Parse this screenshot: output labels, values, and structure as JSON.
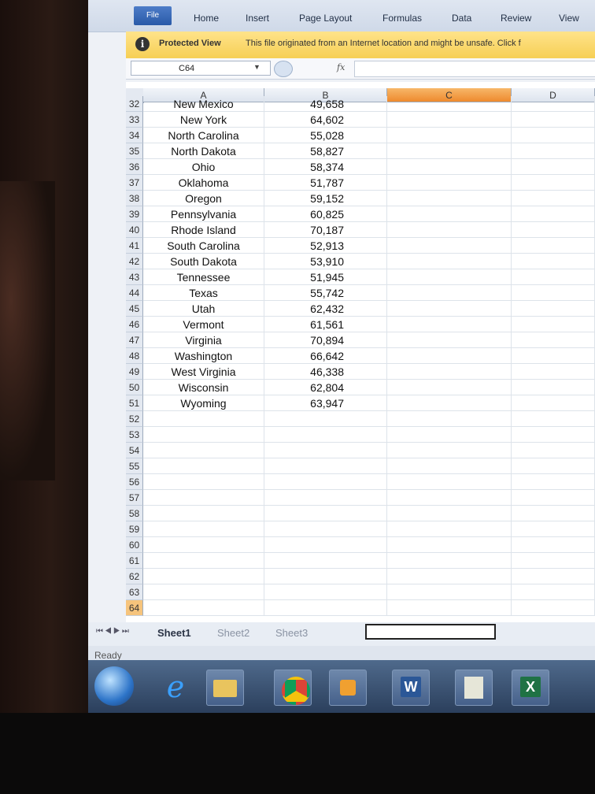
{
  "ribbon": {
    "tabs": [
      "File",
      "Home",
      "Insert",
      "Page Layout",
      "Formulas",
      "Data",
      "Review",
      "View"
    ]
  },
  "protected_view": {
    "label": "Protected View",
    "message": "This file originated from an Internet location and might be unsafe. Click f"
  },
  "formula_bar": {
    "name_box": "C64",
    "fx": "fx",
    "value": ""
  },
  "columns": [
    "A",
    "B",
    "C",
    "D"
  ],
  "selected_column": "C",
  "selected_row": "64",
  "rows": [
    {
      "n": "32",
      "a": "New Mexico",
      "b": "49,658"
    },
    {
      "n": "33",
      "a": "New York",
      "b": "64,602"
    },
    {
      "n": "34",
      "a": "North Carolina",
      "b": "55,028"
    },
    {
      "n": "35",
      "a": "North Dakota",
      "b": "58,827"
    },
    {
      "n": "36",
      "a": "Ohio",
      "b": "58,374"
    },
    {
      "n": "37",
      "a": "Oklahoma",
      "b": "51,787"
    },
    {
      "n": "38",
      "a": "Oregon",
      "b": "59,152"
    },
    {
      "n": "39",
      "a": "Pennsylvania",
      "b": "60,825"
    },
    {
      "n": "40",
      "a": "Rhode Island",
      "b": "70,187"
    },
    {
      "n": "41",
      "a": "South Carolina",
      "b": "52,913"
    },
    {
      "n": "42",
      "a": "South Dakota",
      "b": "53,910"
    },
    {
      "n": "43",
      "a": "Tennessee",
      "b": "51,945"
    },
    {
      "n": "44",
      "a": "Texas",
      "b": "55,742"
    },
    {
      "n": "45",
      "a": "Utah",
      "b": "62,432"
    },
    {
      "n": "46",
      "a": "Vermont",
      "b": "61,561"
    },
    {
      "n": "47",
      "a": "Virginia",
      "b": "70,894"
    },
    {
      "n": "48",
      "a": "Washington",
      "b": "66,642"
    },
    {
      "n": "49",
      "a": "West Virginia",
      "b": "46,338"
    },
    {
      "n": "50",
      "a": "Wisconsin",
      "b": "62,804"
    },
    {
      "n": "51",
      "a": "Wyoming",
      "b": "63,947"
    },
    {
      "n": "52",
      "a": "",
      "b": ""
    },
    {
      "n": "53",
      "a": "",
      "b": ""
    },
    {
      "n": "54",
      "a": "",
      "b": ""
    },
    {
      "n": "55",
      "a": "",
      "b": ""
    },
    {
      "n": "56",
      "a": "",
      "b": ""
    },
    {
      "n": "57",
      "a": "",
      "b": ""
    },
    {
      "n": "58",
      "a": "",
      "b": ""
    },
    {
      "n": "59",
      "a": "",
      "b": ""
    },
    {
      "n": "60",
      "a": "",
      "b": ""
    },
    {
      "n": "61",
      "a": "",
      "b": ""
    },
    {
      "n": "62",
      "a": "",
      "b": ""
    },
    {
      "n": "63",
      "a": "",
      "b": ""
    },
    {
      "n": "64",
      "a": "",
      "b": ""
    }
  ],
  "sheets": [
    "Sheet1",
    "Sheet2",
    "Sheet3"
  ],
  "status": "Ready",
  "taskbar": {
    "apps": [
      "start-orb-icon",
      "internet-explorer-icon",
      "folder-icon",
      "chrome-icon",
      "outlook-icon",
      "word-icon",
      "spreadsheet-icon",
      "excel-icon"
    ],
    "word_glyph": "W",
    "excel_glyph": "X"
  },
  "colors": {
    "protected_bar": "#f6cf55",
    "selected_header": "#ee8a2e",
    "file_tab": "#2a5aa8"
  }
}
